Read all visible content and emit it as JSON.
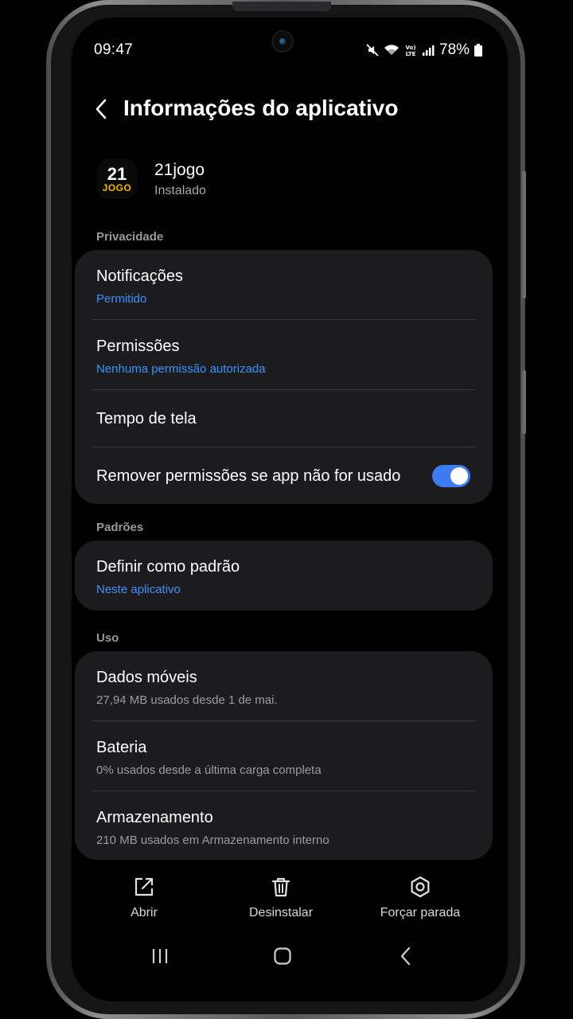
{
  "status_bar": {
    "time": "09:47",
    "battery_percent": "78%",
    "icons": [
      "mute-icon",
      "wifi-icon",
      "volte-icon",
      "signal-icon",
      "battery-icon"
    ]
  },
  "header": {
    "title": "Informações do aplicativo",
    "back_icon": "chevron-left-icon"
  },
  "app": {
    "icon_number": "21",
    "icon_word": "JOGO",
    "name": "21jogo",
    "status": "Instalado"
  },
  "sections": {
    "privacy": {
      "label": "Privacidade",
      "items": [
        {
          "title": "Notificações",
          "subtitle": "Permitido"
        },
        {
          "title": "Permissões",
          "subtitle": "Nenhuma permissão autorizada"
        },
        {
          "title": "Tempo de tela"
        },
        {
          "title": "Remover permissões se app não for usado",
          "toggle_on": true
        }
      ]
    },
    "defaults": {
      "label": "Padrões",
      "items": [
        {
          "title": "Definir como padrão",
          "subtitle": "Neste aplicativo"
        }
      ]
    },
    "usage": {
      "label": "Uso",
      "items": [
        {
          "title": "Dados móveis",
          "subtitle": "27,94 MB usados desde 1 de mai."
        },
        {
          "title": "Bateria",
          "subtitle": "0% usados desde a última carga completa"
        },
        {
          "title": "Armazenamento",
          "subtitle": "210 MB usados em Armazenamento interno"
        }
      ]
    }
  },
  "actions": {
    "open": "Abrir",
    "uninstall": "Desinstalar",
    "force_stop": "Forçar parada"
  },
  "colors": {
    "accent": "#3e91ff",
    "toggle": "#3e7bf2",
    "card": "#1c1c1e",
    "app_icon_word": "#f6b400"
  }
}
